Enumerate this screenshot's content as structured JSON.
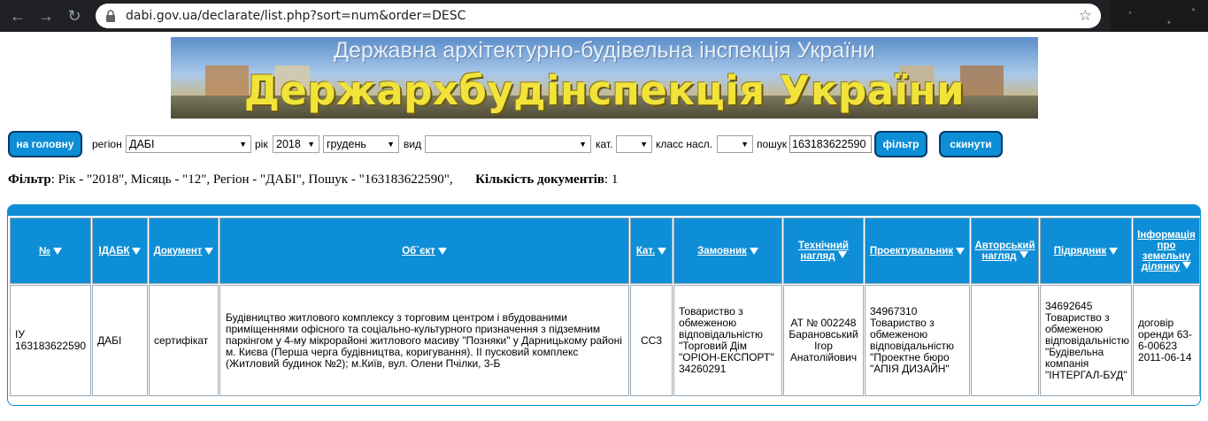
{
  "browser": {
    "url": "dabi.gov.ua/declarate/list.php?sort=num&order=DESC"
  },
  "banner": {
    "subtitle": "Державна архітектурно-будівельна інспекція України",
    "title": "Держархбудінспекція України"
  },
  "filters": {
    "home_button": "на головну",
    "region_label": "регіон",
    "region_value": "ДАБІ",
    "year_label": "рік",
    "year_value": "2018",
    "month_value": "грудень",
    "type_label": "вид",
    "type_value": "",
    "cat_label": "кат.",
    "cat_value": "",
    "class_label": "класс насл.",
    "class_value": "",
    "search_label": "пошук",
    "search_value": "163183622590",
    "filter_button": "фільтр",
    "reset_button": "скинути"
  },
  "summary": {
    "filter_label": "Фільтр",
    "filter_text": ": Рік - \"2018\", Місяць - \"12\", Регіон - \"ДАБІ\", Пошук - \"163183622590\",",
    "count_label": "Кількість документів",
    "count_text": ": 1"
  },
  "table": {
    "headers": [
      "№",
      "ІДАБК",
      "Документ",
      "Об`єкт",
      "Кат.",
      "Замовник",
      "Технічний нагляд",
      "Проектувальник",
      "Авторський нагляд",
      "Підрядник",
      "Інформація про земельну ділянку"
    ],
    "rows": [
      [
        "ІУ 163183622590",
        "ДАБІ",
        "сертифікат",
        "Будівництво житлового комплексу з торговим центром і вбудованими приміщеннями офісного та соціально-культурного призначення з підземним паркінгом у 4-му мікрорайоні житлового масиву \"Позняки\" у Дарницькому районі м. Києва (Перша черга будівництва, коригування). ІІ пусковий комплекс (Житловий будинок №2); м.Київ, вул. Олени Пчілки, 3-Б",
        "СС3",
        "Товариство з обмеженою відповідальністю \"Торговий Дім \"ОРІОН-ЕКСПОРТ\" 34260291",
        "АТ № 002248 Барановський Ігор Анатолійович",
        "34967310 Товариство з обмеженою відповідальністю \"Проектне бюро \"АПІЯ ДИЗАЙН\"",
        "",
        "34692645 Товариство з обмеженою відповідальністю \"Будівельна компанія \"ІНТЕРГАЛ-БУД\"",
        "договір оренди 63-6-00623 2011-06-14"
      ]
    ]
  }
}
